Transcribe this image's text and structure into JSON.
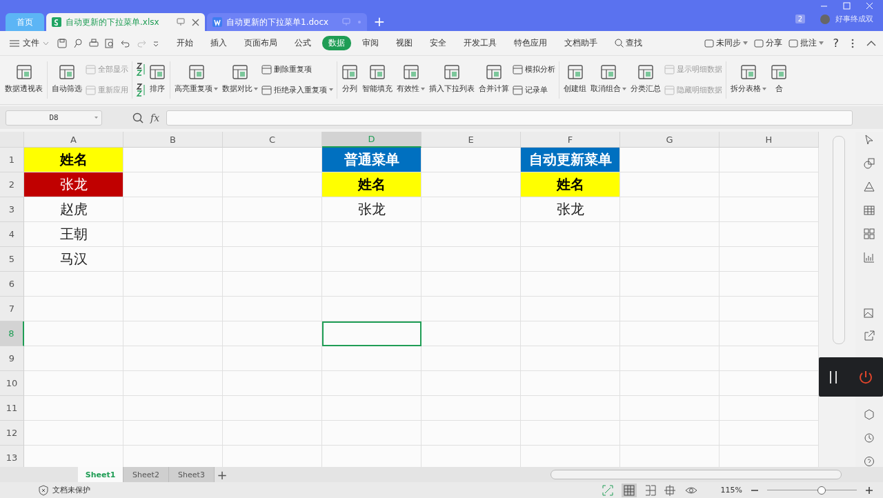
{
  "title_bar": {
    "tabs": [
      {
        "label": "首页",
        "kind": "home",
        "selected": false
      },
      {
        "label": "自动更新的下拉菜单.xlsx",
        "kind": "sheet",
        "selected": true
      },
      {
        "label": "自动更新的下拉菜单1.docx",
        "kind": "doc",
        "selected": false
      }
    ],
    "new_tab": "+",
    "badge": "2",
    "user_name": "好事终成双"
  },
  "menu_bar": {
    "file": "文件",
    "tabs": [
      {
        "label": "开始",
        "selected": false
      },
      {
        "label": "插入",
        "selected": false
      },
      {
        "label": "页面布局",
        "selected": false
      },
      {
        "label": "公式",
        "selected": false
      },
      {
        "label": "数据",
        "selected": true
      },
      {
        "label": "审阅",
        "selected": false
      },
      {
        "label": "视图",
        "selected": false
      },
      {
        "label": "安全",
        "selected": false
      },
      {
        "label": "开发工具",
        "selected": false
      },
      {
        "label": "特色应用",
        "selected": false
      },
      {
        "label": "文档助手",
        "selected": false
      }
    ],
    "search": "查找",
    "actions": [
      {
        "label": "未同步",
        "dropdown": true
      },
      {
        "label": "分享",
        "dropdown": false
      },
      {
        "label": "批注",
        "dropdown": true
      }
    ],
    "help": "?"
  },
  "ribbon": {
    "groups": [
      {
        "columns": [
          [
            {
              "kind": "large",
              "label": "数据透视表",
              "disabled": false,
              "dropdown": false
            }
          ]
        ]
      },
      {
        "columns": [
          [
            {
              "kind": "large",
              "label": "自动筛选",
              "disabled": false,
              "dropdown": false
            }
          ],
          [
            {
              "kind": "small",
              "label": "全部显示",
              "disabled": true,
              "dropdown": false
            },
            {
              "kind": "small",
              "label": "重新应用",
              "disabled": true,
              "dropdown": false
            }
          ]
        ]
      },
      {
        "columns": [
          [
            {
              "kind": "icon",
              "disabled": false
            },
            {
              "kind": "icon",
              "disabled": false
            }
          ],
          [
            {
              "kind": "large",
              "label": "排序",
              "disabled": false,
              "dropdown": false
            }
          ]
        ]
      },
      {
        "columns": [
          [
            {
              "kind": "large",
              "label": "高亮重复项",
              "disabled": false,
              "dropdown": true
            }
          ],
          [
            {
              "kind": "large",
              "label": "数据对比",
              "disabled": false,
              "dropdown": true
            }
          ],
          [
            {
              "kind": "small",
              "label": "删除重复项",
              "disabled": false,
              "dropdown": false
            },
            {
              "kind": "small",
              "label": "拒绝录入重复项",
              "disabled": false,
              "dropdown": true
            }
          ]
        ]
      },
      {
        "columns": [
          [
            {
              "kind": "large",
              "label": "分列",
              "disabled": false,
              "dropdown": false
            }
          ],
          [
            {
              "kind": "large",
              "label": "智能填充",
              "disabled": false,
              "dropdown": false
            }
          ],
          [
            {
              "kind": "large",
              "label": "有效性",
              "disabled": false,
              "dropdown": true
            }
          ],
          [
            {
              "kind": "large",
              "label": "插入下拉列表",
              "disabled": false,
              "dropdown": false
            }
          ],
          [
            {
              "kind": "large",
              "label": "合并计算",
              "disabled": false,
              "dropdown": false
            }
          ],
          [
            {
              "kind": "small",
              "label": "模拟分析",
              "disabled": false,
              "dropdown": false
            },
            {
              "kind": "small",
              "label": "记录单",
              "disabled": false,
              "dropdown": false
            }
          ]
        ]
      },
      {
        "columns": [
          [
            {
              "kind": "large",
              "label": "创建组",
              "disabled": false,
              "dropdown": false
            }
          ],
          [
            {
              "kind": "large",
              "label": "取消组合",
              "disabled": false,
              "dropdown": true
            }
          ],
          [
            {
              "kind": "large",
              "label": "分类汇总",
              "disabled": false,
              "dropdown": false
            }
          ],
          [
            {
              "kind": "small",
              "label": "显示明细数据",
              "disabled": true,
              "dropdown": false
            },
            {
              "kind": "small",
              "label": "隐藏明细数据",
              "disabled": true,
              "dropdown": false
            }
          ]
        ]
      },
      {
        "columns": [
          [
            {
              "kind": "large",
              "label": "拆分表格",
              "disabled": false,
              "dropdown": true
            }
          ],
          [
            {
              "kind": "large",
              "label": "合",
              "disabled": false,
              "dropdown": false
            }
          ]
        ]
      }
    ]
  },
  "formula_bar": {
    "name_box": "D8",
    "fx": "fx"
  },
  "grid": {
    "columns": [
      {
        "label": "A",
        "selected": false
      },
      {
        "label": "B",
        "selected": false
      },
      {
        "label": "C",
        "selected": false
      },
      {
        "label": "D",
        "selected": true
      },
      {
        "label": "E",
        "selected": false
      },
      {
        "label": "F",
        "selected": false
      },
      {
        "label": "G",
        "selected": false
      },
      {
        "label": "H",
        "selected": false
      }
    ],
    "rows": [
      {
        "header": "1",
        "selected": false,
        "cells": [
          {
            "text": "姓名",
            "color": "#ffff00",
            "bold": true,
            "selected": false
          },
          {
            "selected": false
          },
          {
            "selected": false
          },
          {
            "text": "普通菜单",
            "color": "#0070c0",
            "bold": true,
            "selected": false
          },
          {
            "selected": false
          },
          {
            "text": "自动更新菜单",
            "color": "#0070c0",
            "bold": true,
            "selected": false
          },
          {
            "selected": false
          },
          {
            "selected": false
          }
        ]
      },
      {
        "header": "2",
        "selected": false,
        "cells": [
          {
            "text": "张龙",
            "color": "#c00000",
            "bold": false,
            "selected": false
          },
          {
            "selected": false
          },
          {
            "selected": false
          },
          {
            "text": "姓名",
            "color": "#ffff00",
            "bold": true,
            "selected": false
          },
          {
            "selected": false
          },
          {
            "text": "姓名",
            "color": "#ffff00",
            "bold": true,
            "selected": false
          },
          {
            "selected": false
          },
          {
            "selected": false
          }
        ]
      },
      {
        "header": "3",
        "selected": false,
        "cells": [
          {
            "text": "赵虎",
            "bold": false,
            "selected": false
          },
          {
            "selected": false
          },
          {
            "selected": false
          },
          {
            "text": "张龙",
            "bold": false,
            "selected": false
          },
          {
            "selected": false
          },
          {
            "text": "张龙",
            "bold": false,
            "selected": false
          },
          {
            "selected": false
          },
          {
            "selected": false
          }
        ]
      },
      {
        "header": "4",
        "selected": false,
        "cells": [
          {
            "text": "王朝",
            "bold": false,
            "selected": false
          },
          {
            "selected": false
          },
          {
            "selected": false
          },
          {
            "selected": false
          },
          {
            "selected": false
          },
          {
            "selected": false
          },
          {
            "selected": false
          },
          {
            "selected": false
          }
        ]
      },
      {
        "header": "5",
        "selected": false,
        "cells": [
          {
            "text": "马汉",
            "bold": false,
            "selected": false
          },
          {
            "selected": false
          },
          {
            "selected": false
          },
          {
            "selected": false
          },
          {
            "selected": false
          },
          {
            "selected": false
          },
          {
            "selected": false
          },
          {
            "selected": false
          }
        ]
      },
      {
        "header": "6",
        "selected": false,
        "cells": [
          {
            "selected": false
          },
          {
            "selected": false
          },
          {
            "selected": false
          },
          {
            "selected": false
          },
          {
            "selected": false
          },
          {
            "selected": false
          },
          {
            "selected": false
          },
          {
            "selected": false
          }
        ]
      },
      {
        "header": "7",
        "selected": false,
        "cells": [
          {
            "selected": false
          },
          {
            "selected": false
          },
          {
            "selected": false
          },
          {
            "selected": false
          },
          {
            "selected": false
          },
          {
            "selected": false
          },
          {
            "selected": false
          },
          {
            "selected": false
          }
        ]
      },
      {
        "header": "8",
        "selected": true,
        "cells": [
          {
            "selected": false
          },
          {
            "selected": false
          },
          {
            "selected": false
          },
          {
            "selected": true
          },
          {
            "selected": false
          },
          {
            "selected": false
          },
          {
            "selected": false
          },
          {
            "selected": false
          }
        ]
      },
      {
        "header": "9",
        "selected": false,
        "cells": [
          {
            "selected": false
          },
          {
            "selected": false
          },
          {
            "selected": false
          },
          {
            "selected": false
          },
          {
            "selected": false
          },
          {
            "selected": false
          },
          {
            "selected": false
          },
          {
            "selected": false
          }
        ]
      },
      {
        "header": "10",
        "selected": false,
        "cells": [
          {
            "selected": false
          },
          {
            "selected": false
          },
          {
            "selected": false
          },
          {
            "selected": false
          },
          {
            "selected": false
          },
          {
            "selected": false
          },
          {
            "selected": false
          },
          {
            "selected": false
          }
        ]
      },
      {
        "header": "11",
        "selected": false,
        "cells": [
          {
            "selected": false
          },
          {
            "selected": false
          },
          {
            "selected": false
          },
          {
            "selected": false
          },
          {
            "selected": false
          },
          {
            "selected": false
          },
          {
            "selected": false
          },
          {
            "selected": false
          }
        ]
      },
      {
        "header": "12",
        "selected": false,
        "cells": [
          {
            "selected": false
          },
          {
            "selected": false
          },
          {
            "selected": false
          },
          {
            "selected": false
          },
          {
            "selected": false
          },
          {
            "selected": false
          },
          {
            "selected": false
          },
          {
            "selected": false
          }
        ]
      },
      {
        "header": "13",
        "selected": false,
        "cells": [
          {
            "selected": false
          },
          {
            "selected": false
          },
          {
            "selected": false
          },
          {
            "selected": false
          },
          {
            "selected": false
          },
          {
            "selected": false
          },
          {
            "selected": false
          },
          {
            "selected": false
          }
        ]
      }
    ]
  },
  "sheet_tabs": [
    {
      "label": "Sheet1",
      "selected": true
    },
    {
      "label": "Sheet2",
      "selected": false
    },
    {
      "label": "Sheet3",
      "selected": false
    }
  ],
  "add_sheet": "+",
  "status_bar": {
    "protection": "文档未保护",
    "zoom": "115%",
    "zoom_slider": {
      "level": 0.62
    }
  }
}
